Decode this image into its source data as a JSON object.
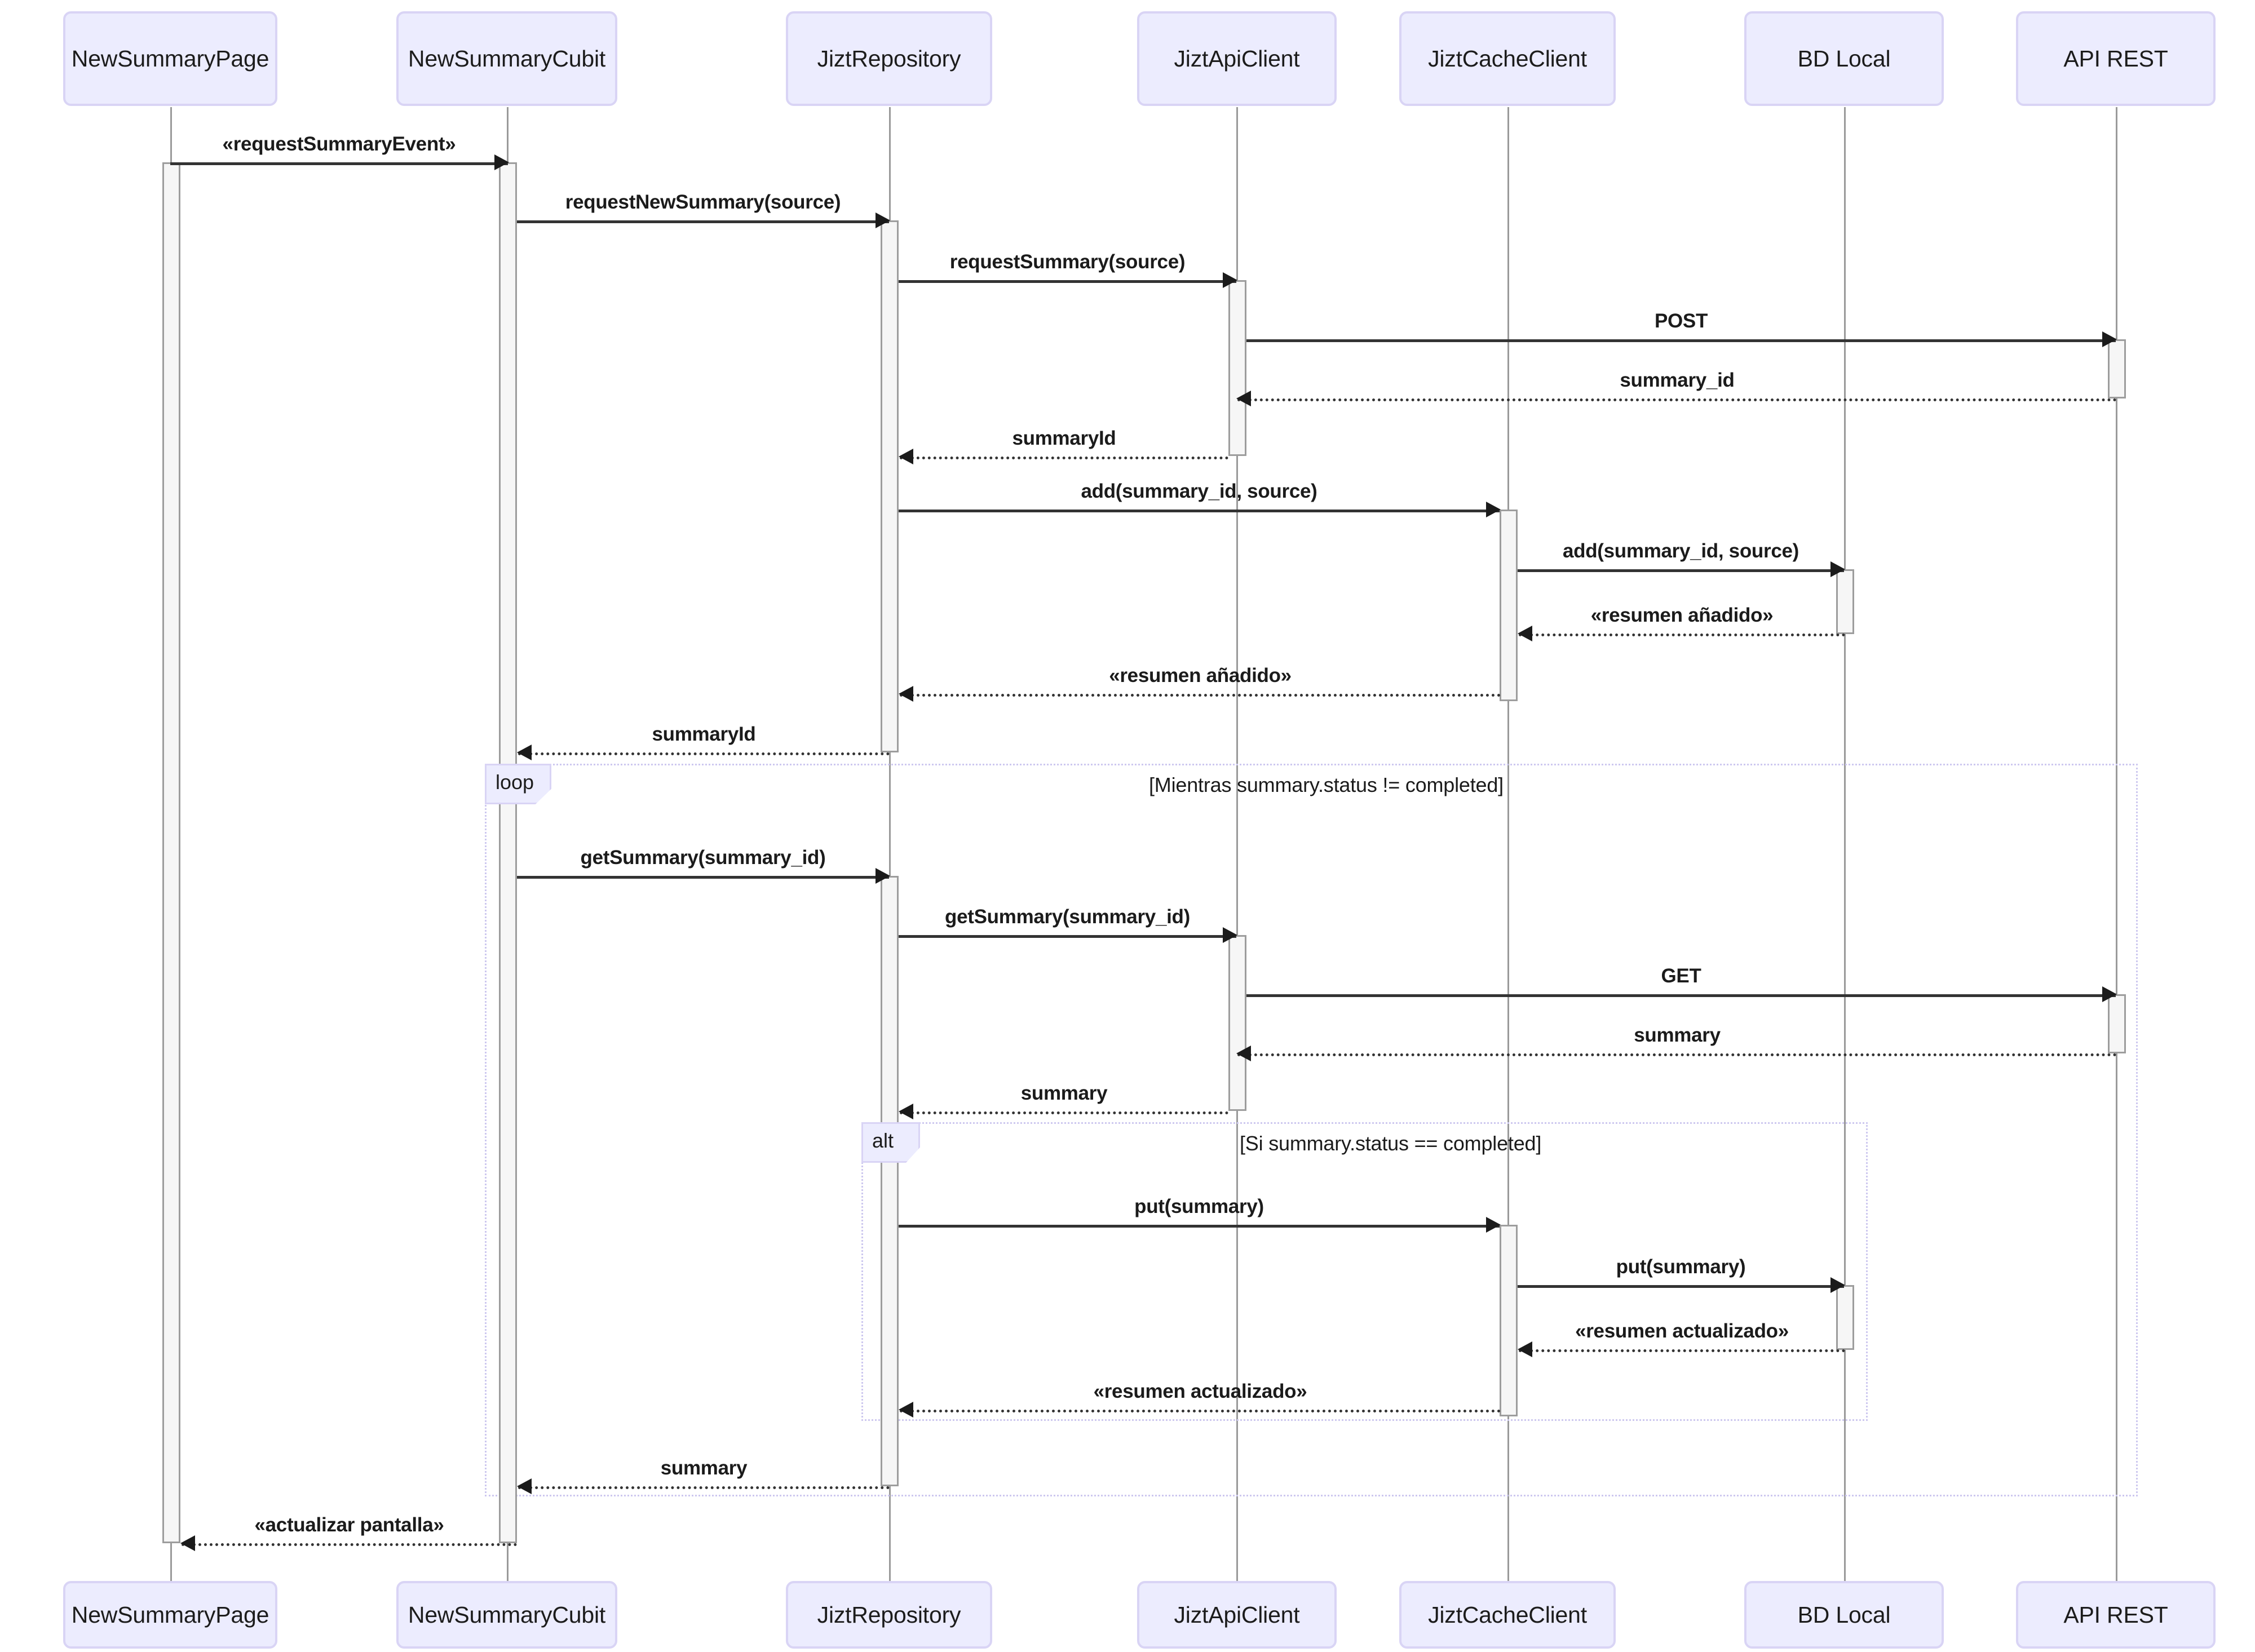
{
  "diagram": {
    "type": "uml-sequence-diagram",
    "title": "",
    "colors": {
      "participant_fill": "#ececfe",
      "participant_border": "#d9d4f5",
      "lifeline": "#9a9a9a",
      "activation_fill": "#f6f6f6",
      "activation_border": "#9d9d9d",
      "message": "#333333",
      "fragment_border": "#cdc8ef",
      "fragment_label_fill": "#ececfe"
    }
  },
  "participants": [
    {
      "id": "page",
      "label": "NewSummaryPage"
    },
    {
      "id": "cubit",
      "label": "NewSummaryCubit"
    },
    {
      "id": "repo",
      "label": "JiztRepository"
    },
    {
      "id": "api",
      "label": "JiztApiClient"
    },
    {
      "id": "cache",
      "label": "JiztCacheClient"
    },
    {
      "id": "bdlocal",
      "label": "BD Local"
    },
    {
      "id": "apirest",
      "label": "API REST"
    }
  ],
  "messages": [
    {
      "id": "m1",
      "label": "«requestSummaryEvent»",
      "from": "page",
      "to": "cubit",
      "kind": "call"
    },
    {
      "id": "m2",
      "label": "requestNewSummary(source)",
      "from": "cubit",
      "to": "repo",
      "kind": "call"
    },
    {
      "id": "m3",
      "label": "requestSummary(source)",
      "from": "repo",
      "to": "api",
      "kind": "call"
    },
    {
      "id": "m4",
      "label": "POST",
      "from": "api",
      "to": "apirest",
      "kind": "call"
    },
    {
      "id": "m5",
      "label": "summary_id",
      "from": "apirest",
      "to": "api",
      "kind": "return"
    },
    {
      "id": "m6",
      "label": "summaryId",
      "from": "api",
      "to": "repo",
      "kind": "return"
    },
    {
      "id": "m7",
      "label": "add(summary_id, source)",
      "from": "repo",
      "to": "cache",
      "kind": "call"
    },
    {
      "id": "m8",
      "label": "add(summary_id, source)",
      "from": "cache",
      "to": "bdlocal",
      "kind": "call"
    },
    {
      "id": "m9",
      "label": "«resumen añadido»",
      "from": "bdlocal",
      "to": "cache",
      "kind": "return"
    },
    {
      "id": "m10",
      "label": "«resumen añadido»",
      "from": "cache",
      "to": "repo",
      "kind": "return"
    },
    {
      "id": "m11",
      "label": "summaryId",
      "from": "repo",
      "to": "cubit",
      "kind": "return"
    },
    {
      "id": "m12",
      "label": "getSummary(summary_id)",
      "from": "cubit",
      "to": "repo",
      "kind": "call"
    },
    {
      "id": "m13",
      "label": "getSummary(summary_id)",
      "from": "repo",
      "to": "api",
      "kind": "call"
    },
    {
      "id": "m14",
      "label": "GET",
      "from": "api",
      "to": "apirest",
      "kind": "call"
    },
    {
      "id": "m15",
      "label": "summary",
      "from": "apirest",
      "to": "api",
      "kind": "return"
    },
    {
      "id": "m16",
      "label": "summary",
      "from": "api",
      "to": "repo",
      "kind": "return"
    },
    {
      "id": "m17",
      "label": "put(summary)",
      "from": "repo",
      "to": "cache",
      "kind": "call"
    },
    {
      "id": "m18",
      "label": "put(summary)",
      "from": "cache",
      "to": "bdlocal",
      "kind": "call"
    },
    {
      "id": "m19",
      "label": "«resumen actualizado»",
      "from": "bdlocal",
      "to": "cache",
      "kind": "return"
    },
    {
      "id": "m20",
      "label": "«resumen actualizado»",
      "from": "cache",
      "to": "repo",
      "kind": "return"
    },
    {
      "id": "m21",
      "label": "summary",
      "from": "repo",
      "to": "cubit",
      "kind": "return"
    },
    {
      "id": "m22",
      "label": "«actualizar pantalla»",
      "from": "cubit",
      "to": "page",
      "kind": "return"
    }
  ],
  "fragments": [
    {
      "id": "f_loop",
      "label": "loop",
      "condition": "[Mientras summary.status != completed]"
    },
    {
      "id": "f_alt",
      "label": "alt",
      "condition": "[Si summary.status == completed]"
    }
  ]
}
